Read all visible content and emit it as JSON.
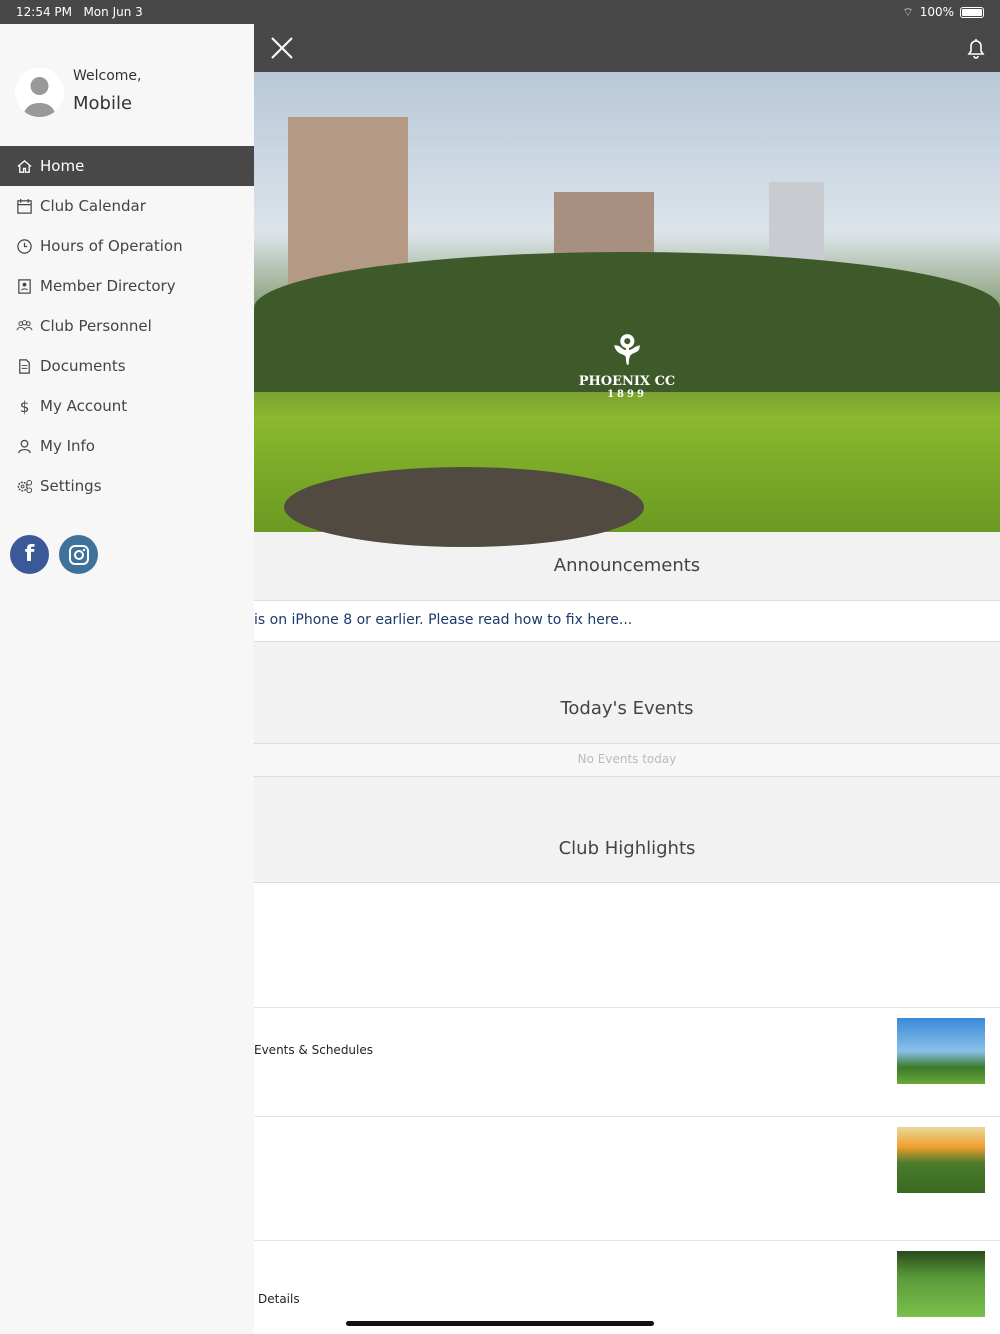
{
  "status": {
    "time": "12:54 PM",
    "date": "Mon Jun 3",
    "battery": "100%"
  },
  "drawer": {
    "welcome": "Welcome,",
    "user_name": "Mobile",
    "items": [
      {
        "label": "Home",
        "icon": "home-icon"
      },
      {
        "label": "Club Calendar",
        "icon": "calendar-icon"
      },
      {
        "label": "Hours of Operation",
        "icon": "clock-icon"
      },
      {
        "label": "Member Directory",
        "icon": "directory-icon"
      },
      {
        "label": "Club Personnel",
        "icon": "people-icon"
      },
      {
        "label": "Documents",
        "icon": "document-icon"
      },
      {
        "label": "My Account",
        "icon": "dollar-icon"
      },
      {
        "label": "My Info",
        "icon": "person-icon"
      },
      {
        "label": "Settings",
        "icon": "gear-icon"
      }
    ]
  },
  "social": {
    "facebook_color": "#3b5998",
    "instagram_color": "#3f729b"
  },
  "hero": {
    "logo_name": "PHOENIX CC",
    "logo_year": "1899"
  },
  "announcements": {
    "title": "Announcements",
    "text": "is on iPhone 8 or earlier. Please read how to fix here..."
  },
  "events": {
    "title": "Today's Events",
    "empty": "No Events today"
  },
  "highlights": {
    "title": "Club Highlights",
    "items": [
      {
        "label": "Events & Schedules"
      },
      {
        "label": ""
      },
      {
        "label": "Details"
      }
    ]
  }
}
